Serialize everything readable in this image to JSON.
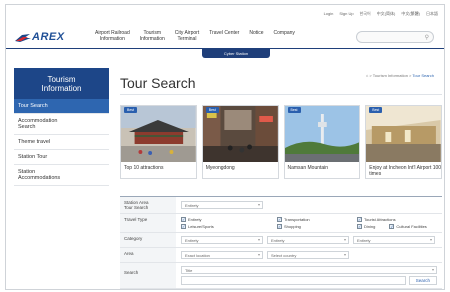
{
  "utility": [
    "Login",
    "Sign Up",
    "한국어",
    "中文(简体)",
    "中文(繁體)",
    "日本語"
  ],
  "brand": {
    "name": "AREX",
    "accent": "#1d4688"
  },
  "gnb": [
    "Airport Railroad\nInformation",
    "Tourism\nInformation",
    "City Airport\nTerminal",
    "Travel Center",
    "Notice",
    "Company"
  ],
  "search": {
    "placeholder": "",
    "icon": "search-icon"
  },
  "subtab": "Cyber Station",
  "sidebar": {
    "title": "Tourism\nInformation",
    "items": [
      {
        "label": "Tour Search",
        "active": true
      },
      {
        "label": "Accommodation\nSearch",
        "active": false
      },
      {
        "label": "Theme travel",
        "active": false
      },
      {
        "label": "Station Tour",
        "active": false
      },
      {
        "label": "Station\nAccommodations",
        "active": false
      }
    ]
  },
  "page": {
    "title": "Tour Search",
    "breadcrumb": [
      "Tourism Information",
      "Tour Search"
    ]
  },
  "cards": [
    {
      "badge": "Best",
      "caption": "Top 10 attractions"
    },
    {
      "badge": "Best",
      "caption": "Myeongdong"
    },
    {
      "badge": "Best",
      "caption": "Namsan Mountain"
    },
    {
      "badge": "Best",
      "caption": "Enjoy at Incheon Int'l Airport 100 times"
    }
  ],
  "form": {
    "station_label": "Station Area\nTour Search",
    "station_value": "Entirety",
    "travel_type_label": "Travel Type",
    "travel_types": [
      "Entirety",
      "Transportation",
      "Tourist Attractions",
      "Leisure/Sports",
      "Shopping",
      "Dining",
      "Cultural Facilities"
    ],
    "category_label": "Category",
    "category_values": [
      "Entirety",
      "Entirety",
      "Entirety"
    ],
    "area_label": "Area",
    "area_values": [
      "Exact location",
      "Select country"
    ],
    "search_label": "Search",
    "search_scope": "Title",
    "search_button": "Search"
  }
}
